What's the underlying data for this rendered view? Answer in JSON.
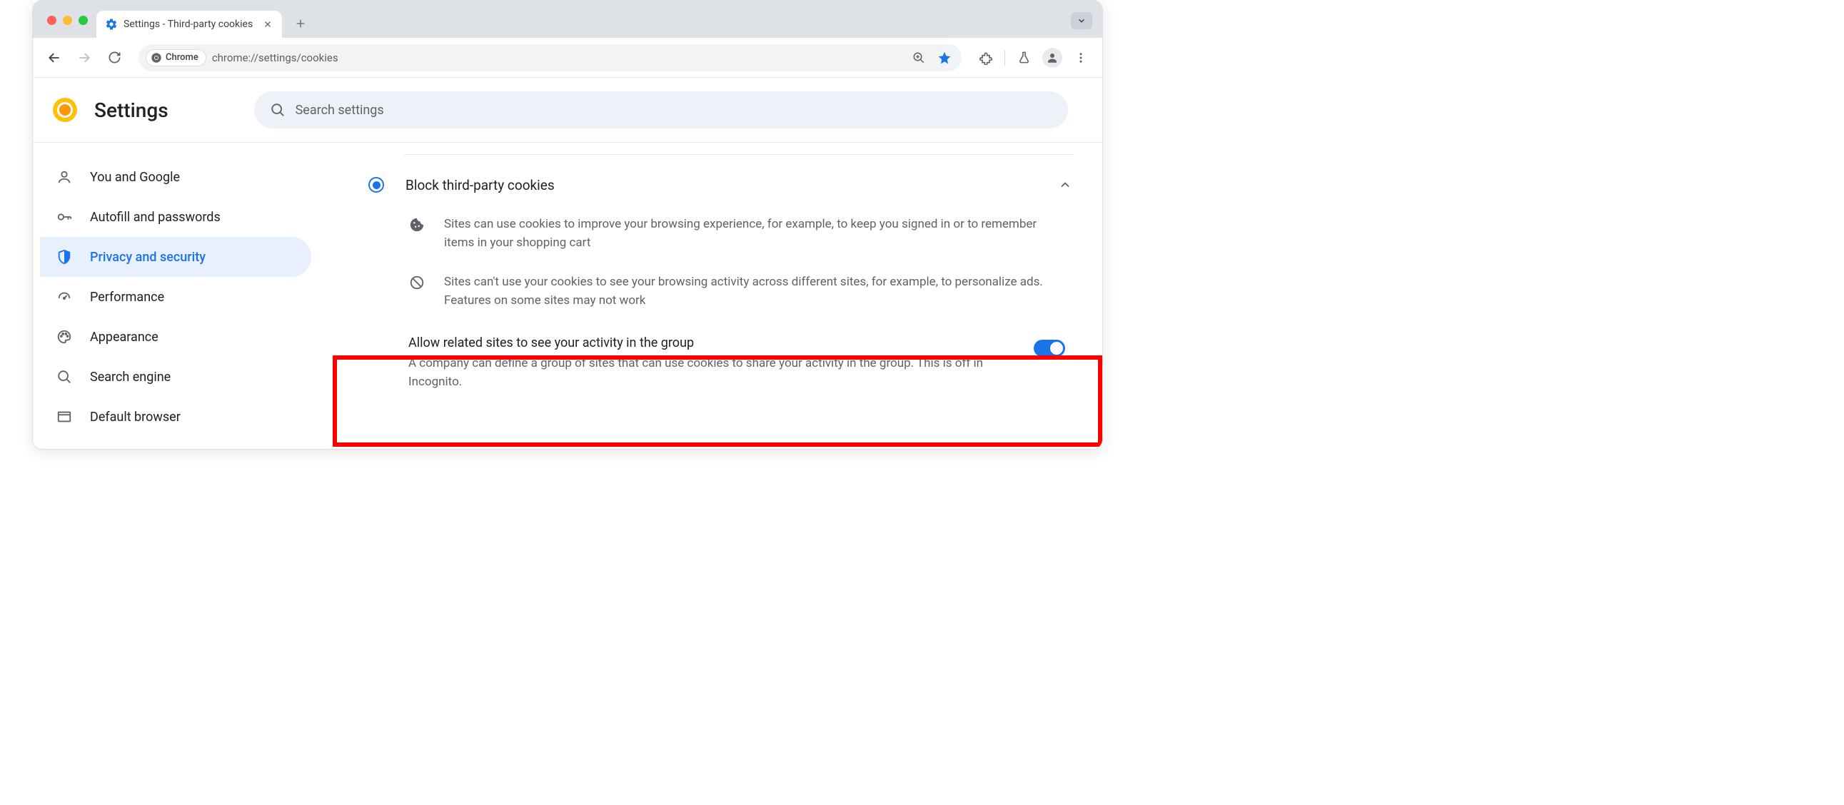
{
  "browser": {
    "tab_title": "Settings - Third-party cookies",
    "url": "chrome://settings/cookies",
    "chip_label": "Chrome"
  },
  "settings_header": {
    "title": "Settings",
    "search_placeholder": "Search settings"
  },
  "sidebar": {
    "items": [
      {
        "label": "You and Google"
      },
      {
        "label": "Autofill and passwords"
      },
      {
        "label": "Privacy and security"
      },
      {
        "label": "Performance"
      },
      {
        "label": "Appearance"
      },
      {
        "label": "Search engine"
      },
      {
        "label": "Default browser"
      }
    ]
  },
  "main": {
    "radio_option": "Block third-party cookies",
    "info1": "Sites can use cookies to improve your browsing experience, for example, to keep you signed in or to remember items in your shopping cart",
    "info2": "Sites can't use your cookies to see your browsing activity across different sites, for example, to personalize ads. Features on some sites may not work",
    "toggle_title": "Allow related sites to see your activity in the group",
    "toggle_desc": "A company can define a group of sites that can use cookies to share your activity in the group. This is off in Incognito.",
    "toggle_on": true
  }
}
